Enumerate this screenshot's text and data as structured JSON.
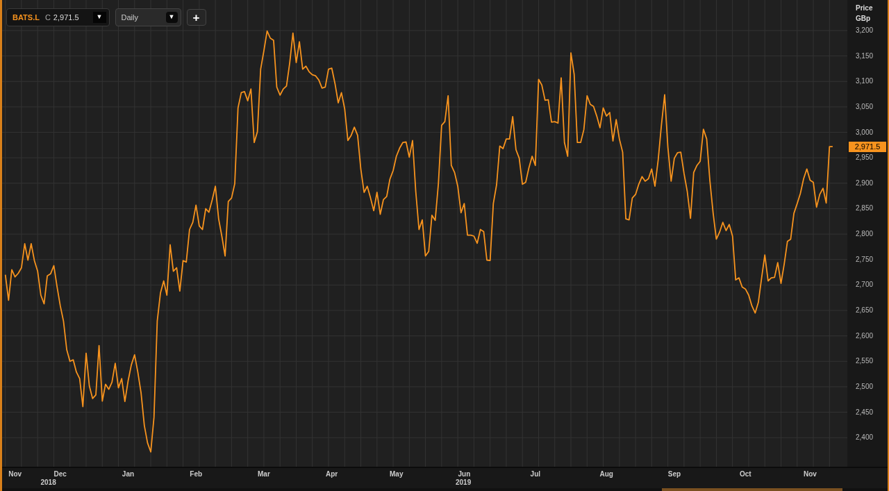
{
  "toolbar": {
    "instrument": {
      "price_type": "C",
      "price": "2,971.5",
      "caret": "▼"
    },
    "interval": {
      "value": "Daily",
      "caret": "▼"
    },
    "add_button": "+"
  },
  "price_axis": {
    "unit": "GBp",
    "last_price": "2,971.5"
  },
  "time_axis": {
    "years": [
      "2018",
      "2019"
    ]
  },
  "chart_data": {
    "type": "line",
    "grid": true,
    "ylabel": "Price",
    "ylim": [
      2343,
      3260
    ],
    "yticks": [
      {
        "value": 2400,
        "label": "2,400"
      },
      {
        "value": 2450,
        "label": "2,450"
      },
      {
        "value": 2500,
        "label": "2,500"
      },
      {
        "value": 2550,
        "label": "2,550"
      },
      {
        "value": 2600,
        "label": "2,600"
      },
      {
        "value": 2650,
        "label": "2,650"
      },
      {
        "value": 2700,
        "label": "2,700"
      },
      {
        "value": 2750,
        "label": "2,750"
      },
      {
        "value": 2800,
        "label": "2,800"
      },
      {
        "value": 2850,
        "label": "2,850"
      },
      {
        "value": 2900,
        "label": "2,900"
      },
      {
        "value": 2950,
        "label": "2,950"
      },
      {
        "value": 3000,
        "label": "3,000"
      },
      {
        "value": 3050,
        "label": "3,050"
      },
      {
        "value": 3100,
        "label": "3,100"
      },
      {
        "value": 3150,
        "label": "3,150"
      },
      {
        "value": 3200,
        "label": "3,200"
      }
    ],
    "categories": [
      null,
      null,
      null,
      "Nov",
      null,
      null,
      null,
      null,
      null,
      null,
      null,
      null,
      null,
      null,
      null,
      null,
      null,
      "Dec",
      null,
      null,
      null,
      null,
      null,
      null,
      null,
      null,
      null,
      null,
      null,
      null,
      null,
      null,
      null,
      null,
      null,
      null,
      null,
      null,
      "Jan",
      null,
      null,
      null,
      null,
      null,
      null,
      null,
      null,
      null,
      null,
      null,
      null,
      null,
      null,
      null,
      null,
      null,
      null,
      null,
      null,
      "Feb",
      null,
      null,
      null,
      null,
      null,
      null,
      null,
      null,
      null,
      null,
      null,
      null,
      null,
      null,
      null,
      null,
      null,
      null,
      null,
      null,
      "Mar",
      null,
      null,
      null,
      null,
      null,
      null,
      null,
      null,
      null,
      null,
      null,
      null,
      null,
      null,
      null,
      null,
      null,
      null,
      null,
      null,
      "Apr",
      null,
      null,
      null,
      null,
      null,
      null,
      null,
      null,
      null,
      null,
      null,
      null,
      null,
      null,
      null,
      null,
      null,
      null,
      null,
      "May",
      null,
      null,
      null,
      null,
      null,
      null,
      null,
      null,
      null,
      null,
      null,
      null,
      null,
      null,
      null,
      null,
      null,
      null,
      null,
      null,
      "Jun",
      null,
      null,
      null,
      null,
      null,
      null,
      null,
      null,
      null,
      null,
      null,
      null,
      null,
      null,
      null,
      null,
      null,
      null,
      null,
      null,
      null,
      "Jul",
      null,
      null,
      null,
      null,
      null,
      null,
      null,
      null,
      null,
      null,
      null,
      null,
      null,
      null,
      null,
      null,
      null,
      null,
      null,
      null,
      null,
      "Aug",
      null,
      null,
      null,
      null,
      null,
      null,
      null,
      null,
      null,
      null,
      null,
      null,
      null,
      null,
      null,
      null,
      null,
      null,
      null,
      null,
      "Sep",
      null,
      null,
      null,
      null,
      null,
      null,
      null,
      null,
      null,
      null,
      null,
      null,
      null,
      null,
      null,
      null,
      null,
      null,
      null,
      null,
      null,
      "Oct",
      null,
      null,
      null,
      null,
      null,
      null,
      null,
      null,
      null,
      null,
      null,
      null,
      null,
      null,
      null,
      null,
      null,
      null,
      null,
      "Nov",
      null,
      null,
      null,
      null,
      null,
      null,
      null
    ],
    "series": [
      {
        "name": "BATS.L",
        "color": "#f7931e",
        "values": [
          2720,
          2670,
          2730,
          2716,
          2723,
          2734,
          2781,
          2749,
          2781,
          2748,
          2727,
          2680,
          2663,
          2718,
          2722,
          2738,
          2697,
          2659,
          2629,
          2573,
          2550,
          2553,
          2529,
          2516,
          2461,
          2566,
          2502,
          2477,
          2484,
          2581,
          2472,
          2505,
          2495,
          2509,
          2546,
          2498,
          2516,
          2471,
          2512,
          2543,
          2563,
          2529,
          2488,
          2424,
          2390,
          2372,
          2440,
          2629,
          2684,
          2708,
          2680,
          2779,
          2727,
          2734,
          2688,
          2748,
          2745,
          2809,
          2823,
          2857,
          2816,
          2809,
          2850,
          2843,
          2867,
          2894,
          2830,
          2796,
          2757,
          2864,
          2871,
          2899,
          3048,
          3078,
          3080,
          3062,
          3085,
          2980,
          3001,
          3124,
          3160,
          3199,
          3185,
          3181,
          3089,
          3073,
          3085,
          3091,
          3137,
          3195,
          3137,
          3178,
          3124,
          3130,
          3119,
          3113,
          3111,
          3103,
          3087,
          3089,
          3124,
          3126,
          3096,
          3058,
          3078,
          3046,
          2984,
          2994,
          3010,
          2994,
          2928,
          2882,
          2894,
          2871,
          2846,
          2882,
          2839,
          2868,
          2874,
          2908,
          2925,
          2953,
          2969,
          2980,
          2981,
          2951,
          2984,
          2884,
          2809,
          2828,
          2757,
          2766,
          2837,
          2827,
          2899,
          3014,
          3021,
          3072,
          2935,
          2921,
          2894,
          2842,
          2860,
          2798,
          2798,
          2796,
          2782,
          2809,
          2805,
          2749,
          2748,
          2860,
          2897,
          2973,
          2968,
          2987,
          2987,
          3031,
          2966,
          2949,
          2898,
          2902,
          2930,
          2953,
          2935,
          3104,
          3093,
          3063,
          3064,
          3020,
          3021,
          3018,
          3107,
          2980,
          2953,
          3156,
          3114,
          2980,
          2980,
          3005,
          3072,
          3055,
          3051,
          3032,
          3009,
          3048,
          3032,
          3039,
          2983,
          3025,
          2987,
          2961,
          2830,
          2828,
          2871,
          2878,
          2898,
          2913,
          2904,
          2909,
          2928,
          2894,
          2946,
          3014,
          3074,
          2971,
          2904,
          2949,
          2960,
          2961,
          2919,
          2884,
          2831,
          2921,
          2935,
          2943,
          3006,
          2987,
          2905,
          2841,
          2790,
          2804,
          2823,
          2807,
          2819,
          2796,
          2710,
          2714,
          2696,
          2692,
          2680,
          2659,
          2645,
          2666,
          2714,
          2759,
          2708,
          2714,
          2715,
          2744,
          2703,
          2741,
          2786,
          2790,
          2841,
          2860,
          2880,
          2909,
          2928,
          2906,
          2902,
          2853,
          2878,
          2890,
          2861,
          2972,
          2972
        ]
      }
    ]
  }
}
